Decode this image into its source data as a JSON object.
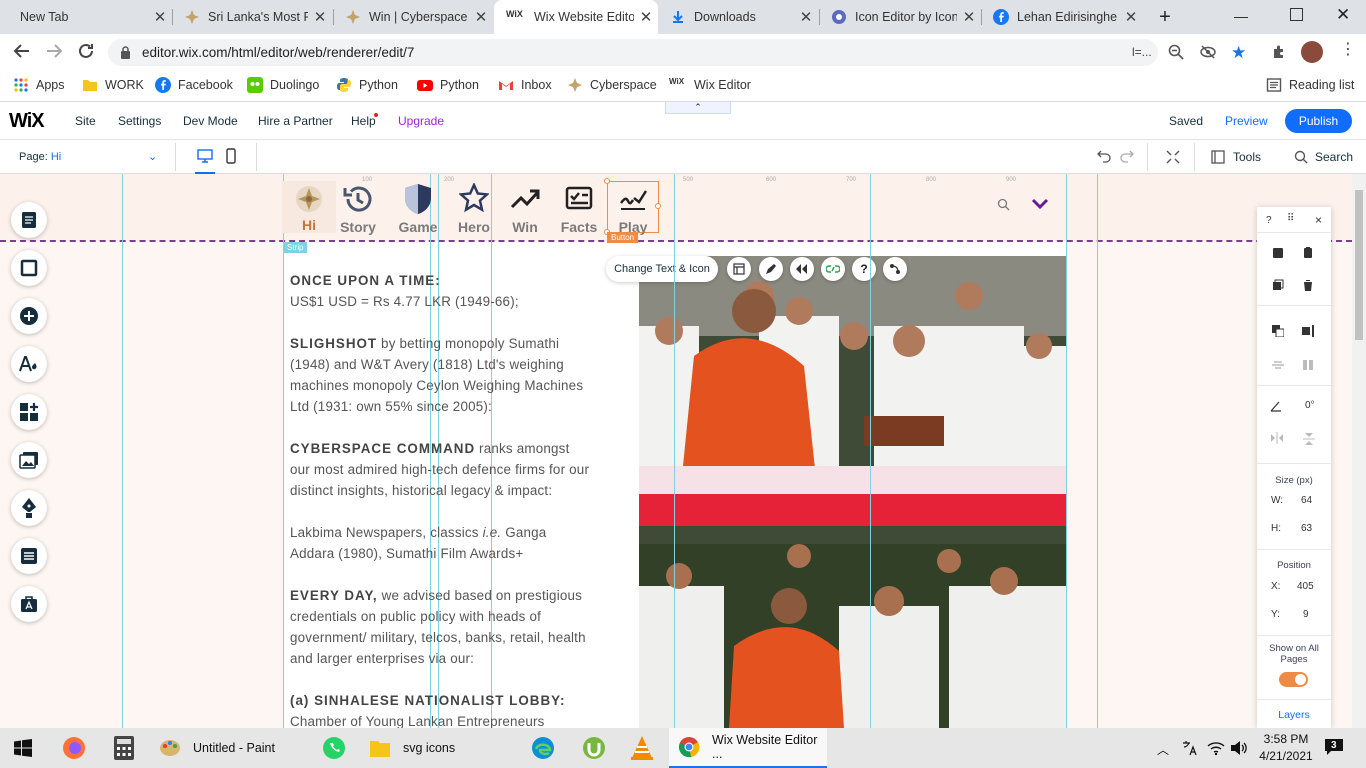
{
  "browser": {
    "tabs": [
      {
        "title": "New Tab"
      },
      {
        "title": "Sri Lanka's Most P"
      },
      {
        "title": "Win | Cyberspace C"
      },
      {
        "title": "Wix Website Edito"
      },
      {
        "title": "Downloads"
      },
      {
        "title": "Icon Editor by Icon"
      },
      {
        "title": "Lehan Edirisinghe"
      }
    ],
    "new_tab": "+",
    "url": "editor.wix.com/html/editor/web/renderer/edit/7",
    "url_suffix": "l=...",
    "bookmarks": [
      {
        "label": "Apps"
      },
      {
        "label": "WORK"
      },
      {
        "label": "Facebook"
      },
      {
        "label": "Duolingo"
      },
      {
        "label": "Python"
      },
      {
        "label": "Python"
      },
      {
        "label": "Inbox"
      },
      {
        "label": "Cyberspace"
      },
      {
        "label": "Wix Editor"
      }
    ],
    "reading_list": "Reading list"
  },
  "wix": {
    "logo": "WiX",
    "menu": [
      "Site",
      "Settings",
      "Dev Mode",
      "Hire a Partner",
      "Help",
      "Upgrade"
    ],
    "saved": "Saved",
    "preview": "Preview",
    "publish": "Publish",
    "page_label": "Page:",
    "page_value": "Hi",
    "tools": "Tools",
    "search": "Search"
  },
  "site_nav": [
    {
      "label": "Hi",
      "icon": "star-badge-icon"
    },
    {
      "label": "Story",
      "icon": "history-icon"
    },
    {
      "label": "Game",
      "icon": "shield-icon"
    },
    {
      "label": "Hero",
      "icon": "star-icon"
    },
    {
      "label": "Win",
      "icon": "trend-up-icon"
    },
    {
      "label": "Facts",
      "icon": "checklist-icon"
    },
    {
      "label": "Play",
      "icon": "signature-icon"
    }
  ],
  "editor_overlay": {
    "strip_tag": "Strip",
    "button_tag": "Button",
    "change_text_icon": "Change Text & Icon",
    "ruler": [
      "100",
      "200",
      "500",
      "600",
      "700",
      "800",
      "900"
    ]
  },
  "article": {
    "p1_head": "ONCE UPON A TIME:",
    "p1_body": "US$1 USD = Rs 4.77 LKR (1949-66);",
    "p2_head": "SLIGHSHOT",
    "p2_body": " by betting monopoly Sumathi (1948) and W&T Avery (1818) Ltd's weighing machines monopoly Ceylon Weighing Machines Ltd (1931: own 55% since 2005):",
    "p3_head": "CYBERSPACE COMMAND",
    "p3_body": " ranks amongst our most admired high-tech defence firms for our distinct insights, historical legacy & impact:",
    "p4_a": "Lakbima Newspapers, classics ",
    "p4_ie": "i.e.",
    "p4_b": " Ganga Addara (1980), Sumathi Film Awards+",
    "p5_head": "EVERY DAY,",
    "p5_body": " we advised based on prestigious credentials on public policy with heads of government/ military, telcos, banks, retail, health and larger enterprises via our:",
    "p6_head": "(a) SINHALESE NATIONALIST LOBBY:",
    "p6_body": "Chamber of Young Lankan Entrepreneurs"
  },
  "right_panel": {
    "help": "?",
    "close": "×",
    "rotation": "0°",
    "size_label": "Size (px)",
    "w_label": "W:",
    "w_value": "64",
    "h_label": "H:",
    "h_value": "63",
    "position_label": "Position",
    "x_label": "X:",
    "x_value": "405",
    "y_label": "Y:",
    "y_value": "9",
    "show_all": "Show on All Pages",
    "layers": "Layers"
  },
  "taskbar": {
    "apps": [
      {
        "label": "Untitled - Paint"
      },
      {
        "label": "svg icons"
      },
      {
        "label": "Wix Website Editor ..."
      }
    ],
    "time": "3:58 PM",
    "date": "4/21/2021",
    "notifications": "3"
  },
  "colors": {
    "wix_blue": "#116dff",
    "upgrade_purple": "#9a27d5",
    "selection_orange": "#f08b45",
    "guide_cyan": "#7fd3e0",
    "robe_orange": "#e4521f"
  }
}
